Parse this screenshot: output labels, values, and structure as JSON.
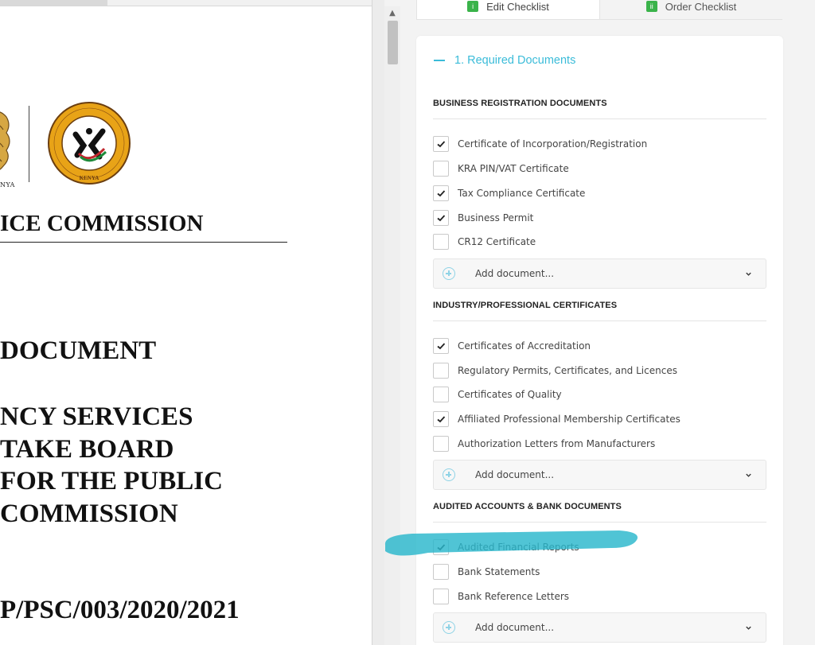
{
  "document": {
    "seal_caption": "NYA",
    "commission_heading": "ICE COMMISSION",
    "title_lines": [
      "DOCUMENT",
      "NCY SERVICES",
      "TAKE BOARD",
      "FOR THE PUBLIC",
      "COMMISSION"
    ],
    "reference": "P/PSC/003/2020/2021"
  },
  "tabs": [
    {
      "label": "Edit Checklist",
      "badge": "i",
      "active": true
    },
    {
      "label": "Order Checklist",
      "badge": "ii",
      "active": false
    }
  ],
  "section": {
    "title": "1. Required Documents",
    "expanded": true
  },
  "groups": [
    {
      "title": "BUSINESS REGISTRATION DOCUMENTS",
      "items": [
        {
          "label": "Certificate of Incorporation/Registration",
          "checked": true
        },
        {
          "label": "KRA PIN/VAT Certificate",
          "checked": false
        },
        {
          "label": "Tax Compliance Certificate",
          "checked": true
        },
        {
          "label": "Business Permit",
          "checked": true
        },
        {
          "label": "CR12 Certificate",
          "checked": false
        }
      ],
      "add_placeholder": "Add document..."
    },
    {
      "title": "INDUSTRY/PROFESSIONAL CERTIFICATES",
      "items": [
        {
          "label": "Certificates of Accreditation",
          "checked": true
        },
        {
          "label": "Regulatory Permits, Certificates, and Licences",
          "checked": false
        },
        {
          "label": "Certificates of Quality",
          "checked": false
        },
        {
          "label": "Affiliated Professional Membership Certificates",
          "checked": true
        },
        {
          "label": "Authorization Letters from Manufacturers",
          "checked": false
        }
      ],
      "add_placeholder": "Add document..."
    },
    {
      "title": "AUDITED ACCOUNTS & BANK DOCUMENTS",
      "items": [
        {
          "label": "Audited Financial Reports",
          "checked": true
        },
        {
          "label": "Bank Statements",
          "checked": false
        },
        {
          "label": "Bank Reference Letters",
          "checked": false
        }
      ],
      "add_placeholder": "Add document..."
    }
  ],
  "colors": {
    "accent": "#3bbcd9",
    "badge": "#3ab34a",
    "highlight": "#2ab7cc"
  },
  "icons": {
    "check": "checkmark-icon",
    "add": "plus-circle-icon",
    "dropdown": "chevron-down-icon",
    "collapse": "minus-icon"
  }
}
